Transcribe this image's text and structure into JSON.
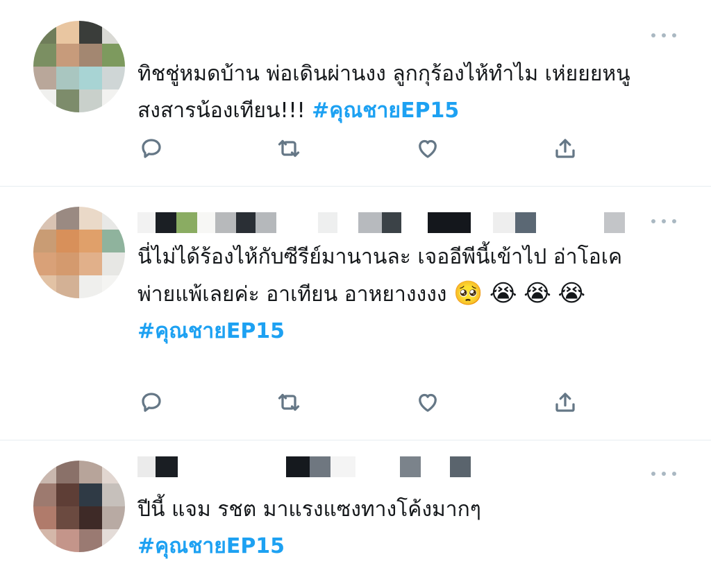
{
  "tweets": [
    {
      "text": "ทิชชู่หมดบ้าน พ่อเดินผ่านงง ลูกกุร้องไห้ทำไม เห่ยยยหนูสงสารน้องเทียน!!!",
      "hashtag": "#คุณชายEP15"
    },
    {
      "text": "นี่ไม่ได้ร้องไห้กับซีรีย์มานานละ เจออีพีนี้เข้าไป อ่าโอเค พ่ายแพ้เลยค่ะ อาเทียน อาหยางงงง",
      "emoji": [
        "🥺",
        "😭",
        "😭",
        "😭"
      ],
      "hashtag": "#คุณชายEP15"
    },
    {
      "text": "ปีนี้ แจม รชต มาแรงแซงทางโค้งมากๆ",
      "hashtag": "#คุณชายEP15"
    }
  ],
  "icons": {
    "more": "more-dots-icon",
    "reply": "reply-icon",
    "retweet": "retweet-icon",
    "like": "heart-icon",
    "share": "share-icon"
  },
  "colors": {
    "hashtag": "#1da1f2",
    "icon": "#657786",
    "divider": "#e6ecf0"
  }
}
